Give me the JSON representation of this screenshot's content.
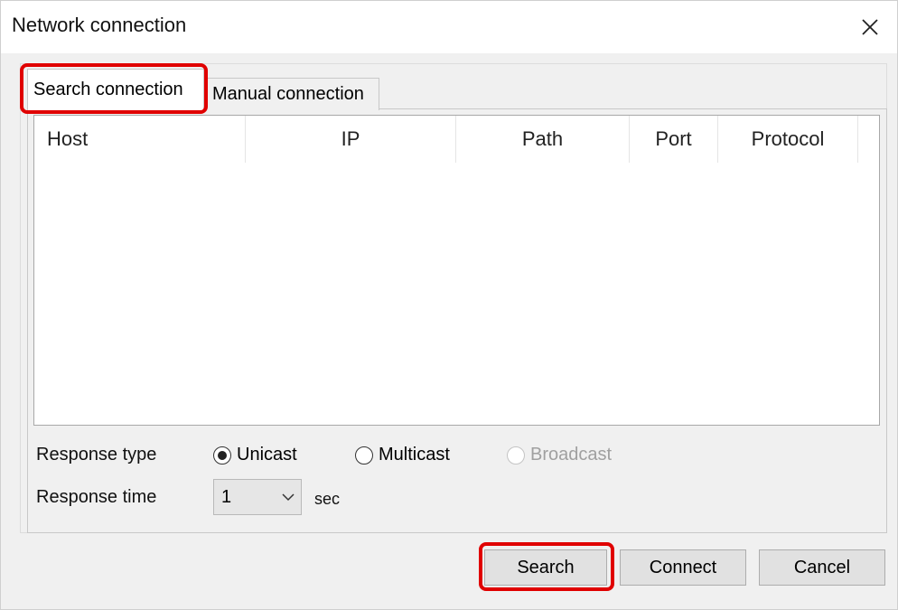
{
  "window": {
    "title": "Network connection",
    "close_icon": "close-icon"
  },
  "tabs": [
    {
      "label": "Search connection",
      "active": true
    },
    {
      "label": "Manual connection",
      "active": false
    }
  ],
  "table": {
    "columns": [
      "Host",
      "IP",
      "Path",
      "Port",
      "Protocol"
    ],
    "rows": []
  },
  "response_type": {
    "label": "Response type",
    "options": [
      {
        "label": "Unicast",
        "selected": true,
        "enabled": true
      },
      {
        "label": "Multicast",
        "selected": false,
        "enabled": true
      },
      {
        "label": "Broadcast",
        "selected": false,
        "enabled": false
      }
    ]
  },
  "response_time": {
    "label": "Response time",
    "value": "1",
    "unit": "sec"
  },
  "buttons": {
    "search": "Search",
    "connect": "Connect",
    "cancel": "Cancel"
  },
  "colors": {
    "highlight": "#e00000",
    "dialog_bg": "#f0f0f0",
    "button_bg": "#e1e1e1"
  }
}
